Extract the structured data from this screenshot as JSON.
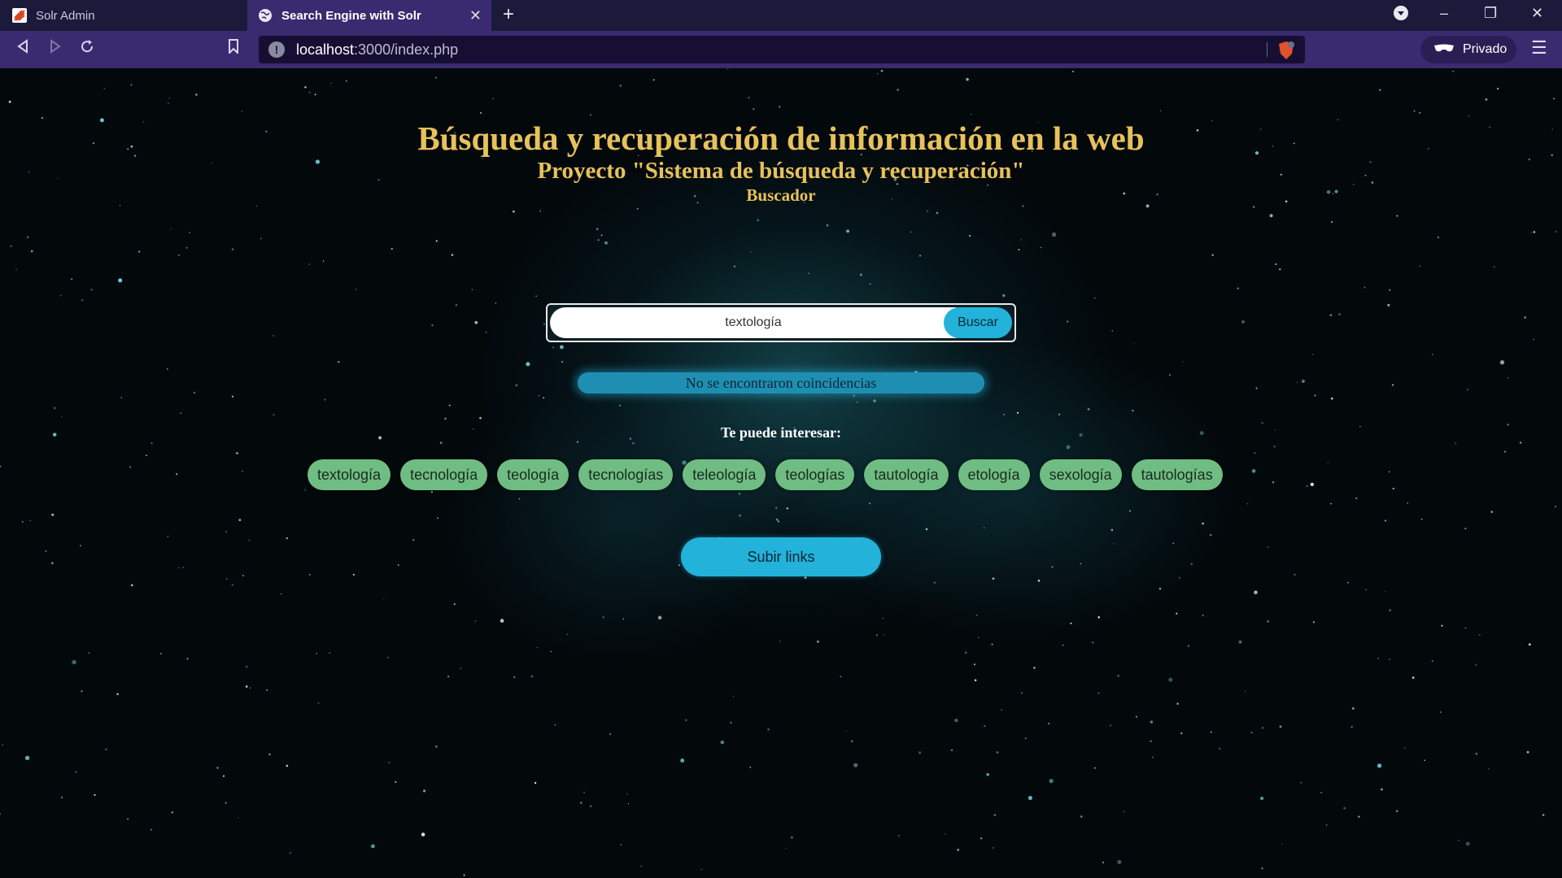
{
  "browser": {
    "tabs": [
      {
        "title": "Solr Admin",
        "icon": "solr-logo-icon",
        "active": false
      },
      {
        "title": "Search Engine with Solr",
        "icon": "globe-icon",
        "active": true
      }
    ],
    "new_tab_icon": "plus-icon",
    "url": {
      "host": "localhost",
      "path": ":3000/index.php"
    },
    "private_label": "Privado",
    "colors": {
      "tabbar": "#1b1a3b",
      "toolbar": "#3a2a6f",
      "urlbar": "#160f33"
    }
  },
  "page": {
    "title": "Búsqueda y recuperación de información en la web",
    "subtitle": "Proyecto \"Sistema de búsqueda y recuperación\"",
    "section": "Buscador",
    "search": {
      "value": "textología",
      "button": "Buscar"
    },
    "no_results": "No se encontraron coincidencias",
    "suggest_label": "Te puede interesar:",
    "suggestions": [
      "textología",
      "tecnología",
      "teología",
      "tecnologías",
      "teleología",
      "teologías",
      "tautología",
      "etología",
      "sexología",
      "tautologías"
    ],
    "upload_button": "Subir links",
    "colors": {
      "title": "#e7c25b",
      "accent": "#22b2da",
      "chip": "#6fbd82",
      "background": "#03080b"
    }
  }
}
